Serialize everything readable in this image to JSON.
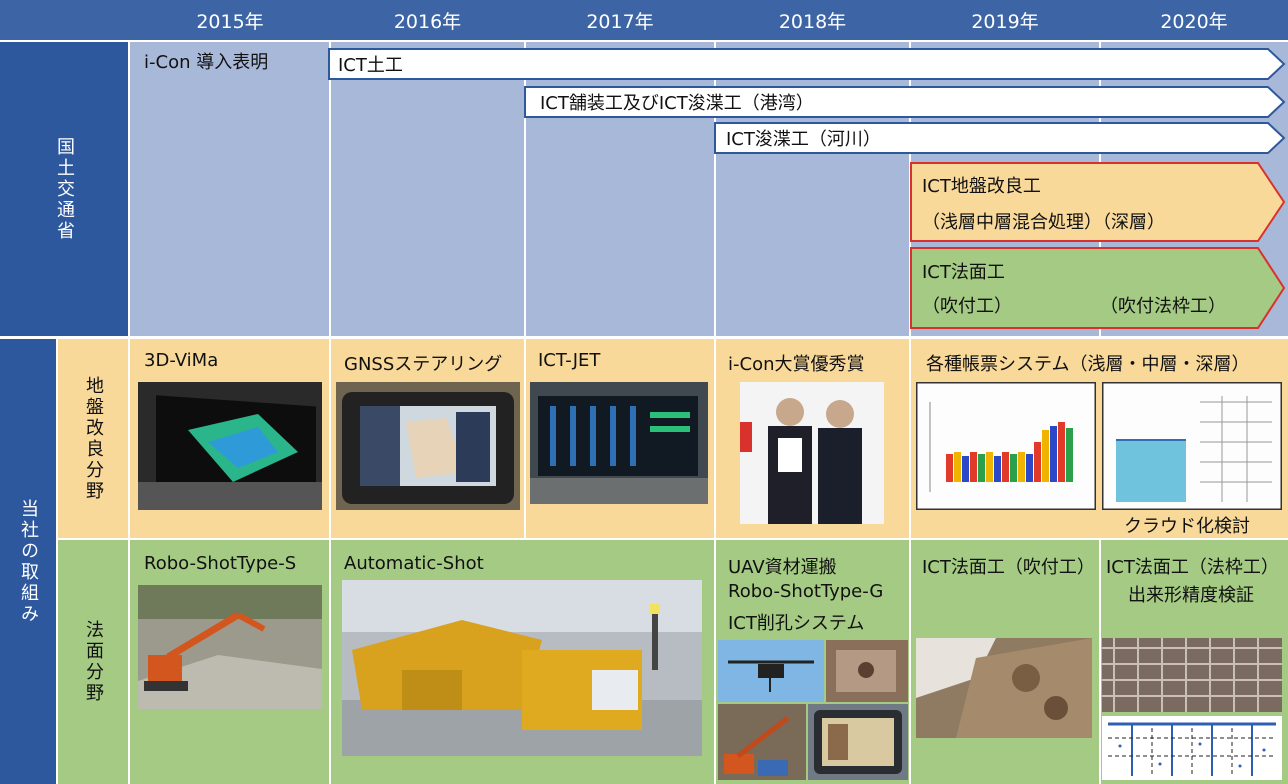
{
  "years": [
    "2015年",
    "2016年",
    "2017年",
    "2018年",
    "2019年",
    "2020年"
  ],
  "sections": {
    "mlit": "国土交通省",
    "company": "当社の取組み",
    "ground": "地盤改良分野",
    "slope": "法面分野"
  },
  "mlit": {
    "icon_declaration": "i-Con 導入表明",
    "arrows": [
      {
        "line1": "ICT土工"
      },
      {
        "line1": "ICT舗装工及びICT浚渫工（港湾）"
      },
      {
        "line1": "ICT浚渫工（河川）"
      },
      {
        "line1": "ICT地盤改良工",
        "line2": "（浅層中層混合処理）（深層）"
      },
      {
        "line1": "ICT法面工",
        "line2a": "（吹付工）",
        "line2b": "（吹付法枠工）"
      }
    ]
  },
  "ground": {
    "items": [
      "3D-ViMa",
      "GNSSステアリング",
      "ICT-JET",
      "i-Con大賞優秀賞",
      "各種帳票システム（浅層・中層・深層）"
    ],
    "cloud": "クラウド化検討"
  },
  "slope": {
    "items": [
      "Robo-ShotType-S",
      "Automatic-Shot"
    ],
    "uav": [
      "UAV資材運搬",
      "Robo-ShotType-G",
      "ICT削孔システム"
    ],
    "slope_2019": "ICT法面工（吹付工）",
    "slope_2020": [
      "ICT法面工（法枠工）",
      "出来形精度検証"
    ]
  },
  "colors": {
    "header": "#3d65a6",
    "mlit_band": "#2d589d",
    "mlit_cells": "#a8b8d8",
    "ground_cells": "#f9d99a",
    "slope_cells": "#a5ca84",
    "arrow_blue": "#2d589d",
    "arrow_red": "#d9312b"
  },
  "icons": [
    "photo-3d-vima",
    "photo-gnss-tablet",
    "photo-ict-jet",
    "photo-award",
    "photo-report-charts",
    "photo-excavator",
    "photo-automatic-shot",
    "photo-uav",
    "photo-slope",
    "photo-grid"
  ]
}
